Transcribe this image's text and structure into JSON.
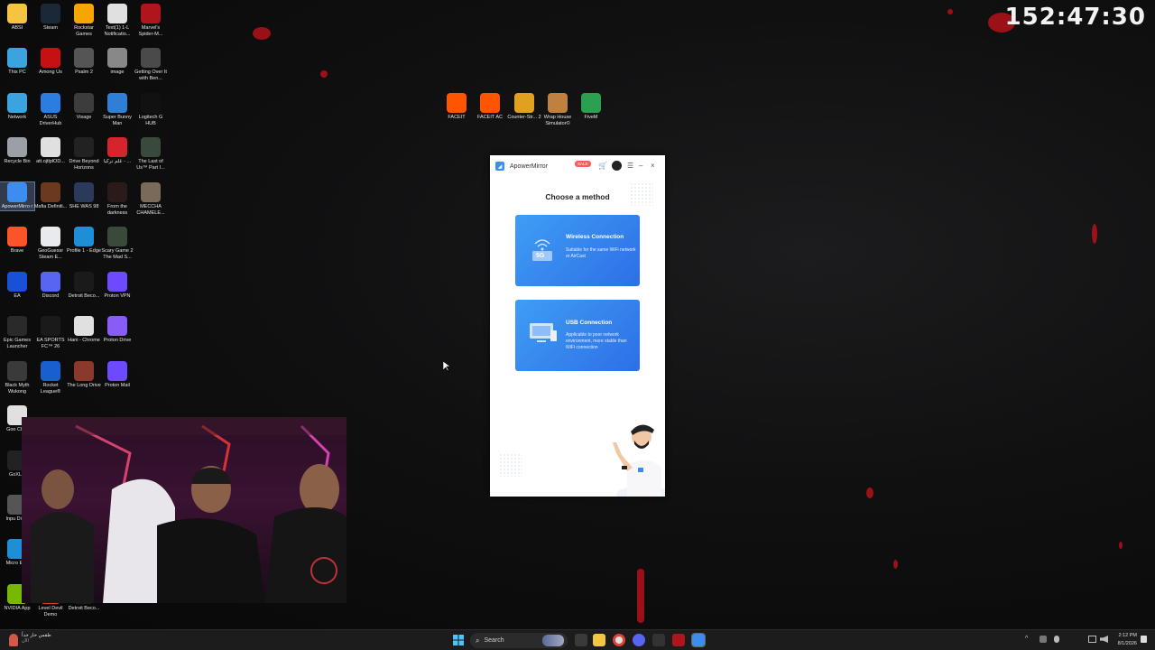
{
  "clock": "152:47:30",
  "desktop_icons": [
    {
      "label": "ABSI",
      "icon": "folder-icon",
      "color": "#f5c542"
    },
    {
      "label": "Steam",
      "icon": "steam-icon",
      "color": "#1b2838"
    },
    {
      "label": "Rockstar Games",
      "icon": "rockstar-icon",
      "color": "#f7a600"
    },
    {
      "label": "Text(1) 1-L Notificatio...",
      "icon": "chrome-icon",
      "color": "#e0e0e0"
    },
    {
      "label": "Marvel's Spider-M...",
      "icon": "spiderman-icon",
      "color": "#b0141c"
    },
    {
      "label": "This PC",
      "icon": "monitor-icon",
      "color": "#3aa3e0"
    },
    {
      "label": "Among Us",
      "icon": "among-us-icon",
      "color": "#c51111"
    },
    {
      "label": "Psalm 2",
      "icon": "psalm-icon",
      "color": "#555555"
    },
    {
      "label": "image",
      "icon": "image-icon",
      "color": "#888888"
    },
    {
      "label": "Getting Over It with Ben...",
      "icon": "getting-over-it-icon",
      "color": "#4a4a4a"
    },
    {
      "label": "Network",
      "icon": "network-icon",
      "color": "#3aa3e0"
    },
    {
      "label": "ASUS DriverHub",
      "icon": "asus-icon",
      "color": "#2a7de1"
    },
    {
      "label": "Visage",
      "icon": "visage-icon",
      "color": "#3c3c3c"
    },
    {
      "label": "Super Bunny Man",
      "icon": "bunny-icon",
      "color": "#2f7fd6"
    },
    {
      "label": "Logitech G HUB",
      "icon": "logitech-icon",
      "color": "#111111"
    },
    {
      "label": "Recycle Bin",
      "icon": "recycle-bin-icon",
      "color": "#9aa0a6"
    },
    {
      "label": "att.ojtlplOD...",
      "icon": "chrome-icon",
      "color": "#e0e0e0"
    },
    {
      "label": "Drive Beyond Horizons",
      "icon": "drive-beyond-icon",
      "color": "#222222"
    },
    {
      "label": "عَلَم تركيا - ...",
      "icon": "flag-icon",
      "color": "#d6242c"
    },
    {
      "label": "The Last of Us™ Part I...",
      "icon": "last-of-us-icon",
      "color": "#3a4a3a"
    },
    {
      "label": "ApowerMirro r",
      "icon": "apowermirror-icon",
      "color": "#3d8cf0"
    },
    {
      "label": "Mafia Definiti...",
      "icon": "mafia-icon",
      "color": "#6b3a1e"
    },
    {
      "label": "SHE WAS 98",
      "icon": "she-was-98-icon",
      "color": "#2b3a5a"
    },
    {
      "label": "From the darkness",
      "icon": "darkness-icon",
      "color": "#2a1a1a"
    },
    {
      "label": "MECCHA CHAMELE...",
      "icon": "chameleon-icon",
      "color": "#7a6a5a"
    },
    {
      "label": "Brave",
      "icon": "brave-icon",
      "color": "#fb542b"
    },
    {
      "label": "GeoGuessr Steam E...",
      "icon": "geoguessr-icon",
      "color": "#e8eaed"
    },
    {
      "label": "Profile 1 - Edge",
      "icon": "edge-icon",
      "color": "#1e8fd6"
    },
    {
      "label": "Scary Game 2 The Mad S...",
      "icon": "scary-game-icon",
      "color": "#3a4a3a"
    },
    {
      "label": "EA",
      "icon": "ea-icon",
      "color": "#1a4fd8"
    },
    {
      "label": "Discord",
      "icon": "discord-icon",
      "color": "#5865f2"
    },
    {
      "label": "Detroit Beco...",
      "icon": "detroit-icon",
      "color": "#1a1a1a"
    },
    {
      "label": "Proton VPN",
      "icon": "proton-vpn-icon",
      "color": "#6d4aff"
    },
    {
      "label": "Epic Games Launcher",
      "icon": "epic-icon",
      "color": "#2a2a2a"
    },
    {
      "label": "EA SPORTS FC™ 26",
      "icon": "fc26-icon",
      "color": "#1a1a1a"
    },
    {
      "label": "Hani - Chrome",
      "icon": "chrome-icon",
      "color": "#e0e0e0"
    },
    {
      "label": "Proton Drive",
      "icon": "proton-drive-icon",
      "color": "#8a5cf6"
    },
    {
      "label": "Black Myth Wukong",
      "icon": "wukong-icon",
      "color": "#3a3a3a"
    },
    {
      "label": "Rocket League®",
      "icon": "rocket-league-icon",
      "color": "#1a5fd0"
    },
    {
      "label": "The Long Drive",
      "icon": "long-drive-icon",
      "color": "#8a3a2a"
    },
    {
      "label": "Proton Mail",
      "icon": "proton-mail-icon",
      "color": "#6d4aff"
    },
    {
      "label": "Goo Chro",
      "icon": "chrome-icon",
      "color": "#e0e0e0"
    },
    {
      "label": "GoXLR",
      "icon": "goxlr-icon",
      "color": "#222222"
    },
    {
      "label": "Inpu Direc",
      "icon": "input-direct-icon",
      "color": "#555555"
    },
    {
      "label": "Micro Edg",
      "icon": "edge-icon",
      "color": "#1e8fd6"
    },
    {
      "label": "NVIDIA App",
      "icon": "nvidia-icon",
      "color": "#76b900"
    },
    {
      "label": "Level Devil Demo",
      "icon": "level-devil-icon",
      "color": "#d04020"
    },
    {
      "label": "Detroit Beco...",
      "icon": "detroit-icon",
      "color": "#1a1a1a"
    },
    {
      "label": "FACEIT",
      "icon": "faceit-icon",
      "color": "#ff5500"
    },
    {
      "label": "FACEIT AC",
      "icon": "faceit-ac-icon",
      "color": "#ff5500"
    },
    {
      "label": "Counter-Str... 2",
      "icon": "cs2-icon",
      "color": "#e0a020"
    },
    {
      "label": "Wrap House Simulator©",
      "icon": "wrap-house-icon",
      "color": "#c08040"
    },
    {
      "label": "FiveM",
      "icon": "fivem-icon",
      "color": "#2aa050"
    }
  ],
  "app": {
    "title": "ApowerMirror",
    "sale_badge": "SALE",
    "heading": "Choose a method",
    "methods": [
      {
        "title": "Wireless Connection",
        "desc": "Suitable for the same WiFi network or AirCast",
        "badge": "5G"
      },
      {
        "title": "USB Connection",
        "desc": "Applicable to poor network environment, more stable than WiFi connection"
      }
    ],
    "controls": {
      "cart": "🛒",
      "menu": "☰",
      "minimize": "–",
      "close": "×"
    }
  },
  "taskbar": {
    "search_placeholder": "Search",
    "weather_text": "طقس حار جداً",
    "weather_sub": "الآن",
    "time": "2:12 PM",
    "date": "8/1/2026"
  }
}
